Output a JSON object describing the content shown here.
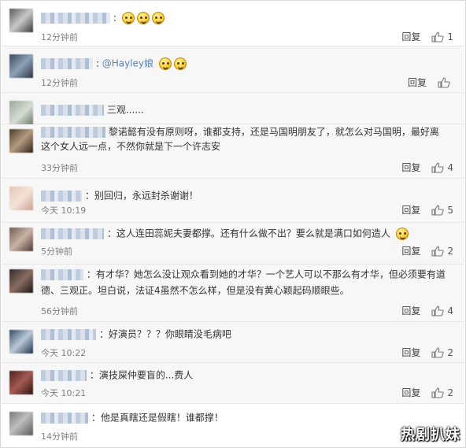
{
  "comments": [
    {
      "text": ":",
      "emoji_count": 3,
      "time": "12分钟前",
      "reply": "回复",
      "likes": "1"
    },
    {
      "text": ":",
      "mention": "@Hayley娘",
      "emoji_count": 2,
      "time": "12分钟前",
      "reply": "回复",
      "likes": ""
    },
    {
      "text": "三观......",
      "time": "",
      "reply": "",
      "likes": ""
    },
    {
      "text": "黎诺懿有没有原则呀，谁都支持，还是马国明朋友了，就怎么对马国明，最好离",
      "text2": "这个女人远一点，不然你就是下一个许志安",
      "time": "33分钟前",
      "reply": "回复",
      "likes": "4"
    },
    {
      "text": "：别回归，永远封杀谢谢！",
      "time": "今天 10:19",
      "reply": "回复",
      "likes": "5"
    },
    {
      "text": "：这人连田蕊妮夫妻都撑。还有什么做不出？要么就是满口如何造人",
      "emoji_count": 1,
      "time": "5分钟前",
      "reply": "回复",
      "likes": "2"
    },
    {
      "text": "：有才华？她怎么没让观众看到她的才华？一个艺人可以不那么有才华，但必须要有道",
      "text2": "德、三观正。坦白说，法证4虽然不怎么样，但是没有黄心颖起码顺眼些。",
      "time": "56分钟前",
      "reply": "回复",
      "likes": "4"
    },
    {
      "text": "：好演员？？？你眼睛没毛病吧",
      "time": "今天 10:22",
      "reply": "回复",
      "likes": "2"
    },
    {
      "text": "：演技屎仲要盲的...费人",
      "time": "今天 10:21",
      "reply": "回复",
      "likes": "2"
    },
    {
      "text": "：他是真瞎还是假瞎！谁都撑！",
      "time": "14分钟前",
      "reply": "",
      "likes": ""
    }
  ],
  "watermark": "热剧扒妹",
  "colors": {
    "mention": "#5a7fb7",
    "meta": "#808080",
    "border": "#e6e6e6"
  }
}
